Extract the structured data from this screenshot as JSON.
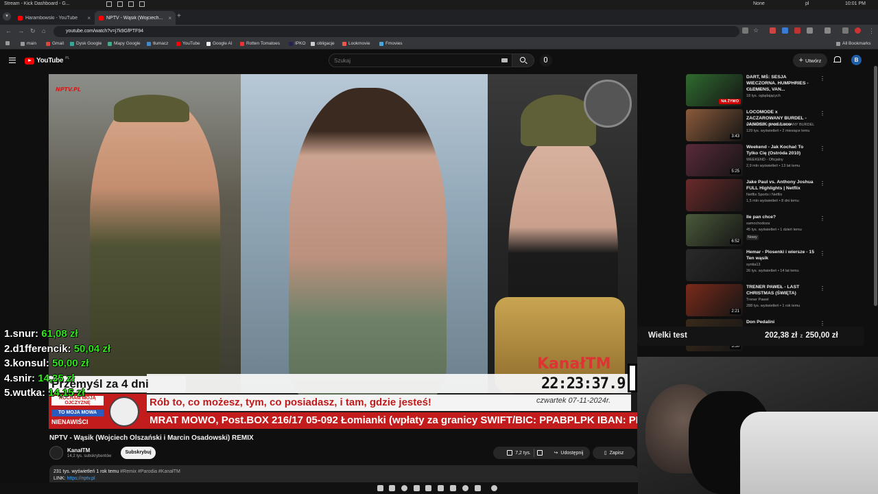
{
  "os_bar": {
    "window_title": "Stream - Kick Dashboard - G...",
    "tray_profile": "None",
    "tray_lang": "pl",
    "clock": "10:01 PM"
  },
  "tabs": [
    {
      "label": "Harambowski - YouTube",
      "active": false
    },
    {
      "label": "NPTV - Wąsik (Wojciech...",
      "active": true
    }
  ],
  "address": {
    "url": "youtube.com/watch?v=j7k9GfPTF94"
  },
  "bookmarks": {
    "items": [
      "main",
      "Gmail",
      "Dysk Google",
      "Mapy Google",
      "tłumacz",
      "YouTube",
      "Google AI",
      "Rotten Tomatoes",
      "IPKO",
      "obligacje",
      "Lookmovie",
      "Fmovies"
    ],
    "all_label": "All Bookmarks"
  },
  "youtube": {
    "logo": "YouTube",
    "region": "PL",
    "search_placeholder": "Szukaj",
    "create_label": "Utwórz",
    "avatar_letter": "B"
  },
  "video_overlay": {
    "logo_main": "NPTV",
    "logo_suffix": ".PL",
    "location": "Przemyśl za 4 dni",
    "clock": "22:23:37.9",
    "slogan": "Rób to, co możesz, tym, co posiadasz, i tam, gdzie jesteś!",
    "date": "czwartek 07-11-2024r.",
    "ticker": "MRAT MOWO, Post.BOX 216/17 05-092 Łomianki (wpłaty za granicy SWIFT/BIC: PPABPLPK IBAN: PL)",
    "kocham_l1": "KOCHAM MOJĄ OJCZYZNĘ",
    "kocham_l2": "TO MOJA MOWA",
    "kocham_l3": "NIENAWIŚCI",
    "watermark_a": "Kanał",
    "watermark_b": "TM"
  },
  "leaderboard": [
    {
      "rank_name": "1.snur:",
      "amount": "61,08 zł"
    },
    {
      "rank_name": "2.d1fferencik:",
      "amount": "50,04 zł"
    },
    {
      "rank_name": "3.konsul:",
      "amount": "50,00 zł"
    },
    {
      "rank_name": "4.snir:",
      "amount": "14,35 zł"
    },
    {
      "rank_name": "5.wutka:",
      "amount": "14,15 zł"
    }
  ],
  "video_info": {
    "title": "NPTV - Wąsik (Wojciech Olszański i Marcin Osadowski) REMIX",
    "channel": "KanałTM",
    "subs": "14,2 tys. subskrybentów",
    "subscribe_label": "Subskrybuj",
    "likes": "7,2 tys.",
    "share_label": "Udostępnij",
    "save_label": "Zapisz",
    "views": "231 tys. wyświetleń  1 rok temu",
    "hashtags": "#Remix #Parodia #KanałTM",
    "link_label": "LINK:",
    "link": "https://nptv.pl"
  },
  "recommendations": [
    {
      "title": "DART, MŚ: SESJA WIECZORNA. HUMPHRIES - CLEMENS, VAN...",
      "channel": "TVP Sport",
      "meta": "18 tys. oglądających",
      "badge": "NA ŻYWO",
      "color": "#2f6b2f"
    },
    {
      "title": "LOCOMODE x ZACZAROWANY BURDEL - JANOSIK prod.Loco",
      "channel": "PurpleHaze i ZACZAROWANY BURDEL",
      "meta": "129 tys. wyświetleń • 2 miesiące temu",
      "duration": "3:43",
      "color": "#8a5a3a"
    },
    {
      "title": "Weekend - Jak Kochać To Tylko Cię (Ostróda 2010)",
      "channel": "WEEKEND - Oficjalny",
      "meta": "2,9 mln wyświetleń • 13 lat temu",
      "duration": "5:25",
      "color": "#5a2a3a"
    },
    {
      "title": "Jake Paul vs. Anthony Joshua FULL Highlights | Netflix",
      "channel": "Netflix Sports i Netflix",
      "meta": "1,5 mln wyświetleń • 8 dni temu",
      "duration": "",
      "color": "#6a2a2a"
    },
    {
      "title": "Ile pan chce?",
      "channel": "samochodoza",
      "meta": "45 tys. wyświetleń • 1 dzień temu",
      "new": "Nowy",
      "duration": "6:52",
      "color": "#4a5a3a"
    },
    {
      "title": "Hemar - Piosenki i wiersze - 15 Ten wąsik",
      "channel": "syntia13",
      "meta": "26 tys. wyświetleń • 14 lat temu",
      "duration": "",
      "color": "#2a2a2a"
    },
    {
      "title": "TRENER PAWEŁ -  LAST CHRISTMAS (ŚWIĘTA)",
      "channel": "Trener Paweł",
      "meta": "288 tys. wyświetleń • 1 rok temu",
      "duration": "2:21",
      "color": "#7a2a1a"
    },
    {
      "title": "Don Pedalini",
      "channel": "",
      "meta": "",
      "duration": "3:50",
      "color": "#3a2a1a"
    }
  ],
  "goal": {
    "name": "Wielki test",
    "current": "202,38 zł",
    "separator": "z",
    "target": "250,00 zł"
  }
}
